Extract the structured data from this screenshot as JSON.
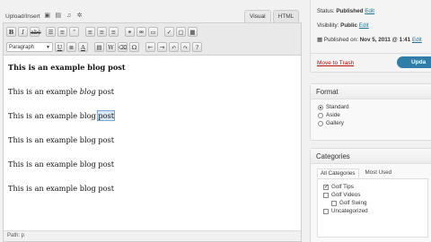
{
  "editor": {
    "upload_label": "Upload/Insert",
    "upload_icons": [
      "image-icon",
      "video-icon",
      "audio-icon",
      "media-icon"
    ],
    "tabs": {
      "visual": "Visual",
      "html": "HTML"
    },
    "toolbar_row1": [
      "B",
      "I",
      "abc",
      "list",
      "list",
      "quote",
      "left",
      "center",
      "right",
      "link",
      "unlink",
      "more",
      "spell",
      "full",
      "kitchen"
    ],
    "toolbar_row2": [
      "U",
      "justify",
      "A",
      "paste-text",
      "paste-word",
      "clear",
      "char",
      "outdent",
      "indent",
      "undo",
      "redo",
      "help"
    ],
    "paragraph_select": "Paragraph",
    "content": {
      "line1": "This is an example blog post",
      "line2_before": "This is an example ",
      "line2_em": "blog",
      "line2_after": " post",
      "line3_before": "This is an example blog ",
      "line3_selected": "post",
      "line4": "This is an example blog post",
      "line5": "This is an example blog post",
      "line6": "This is an example blog post"
    },
    "path": "Path: p"
  },
  "publish": {
    "status_label": "Status: ",
    "status_value": "Published",
    "status_edit": "Edit",
    "visibility_label": "Visibility: ",
    "visibility_value": "Public",
    "visibility_edit": "Edit",
    "published_on": "Published on: ",
    "published_date": "Nov 5, 2011 @ 1:41",
    "published_edit": "Edit",
    "trash": "Move to Trash",
    "update": "Upda"
  },
  "format": {
    "title": "Format",
    "options": [
      "Standard",
      "Aside",
      "Gallery"
    ],
    "selected": "Standard"
  },
  "categories": {
    "title": "Categories",
    "tab_all": "All Categories",
    "tab_used": "Most Used",
    "items": [
      {
        "label": "Golf Tips",
        "checked": true,
        "child": false
      },
      {
        "label": "Golf Videos",
        "checked": false,
        "child": false
      },
      {
        "label": "Golf Swing",
        "checked": false,
        "child": true
      },
      {
        "label": "Uncategorized",
        "checked": false,
        "child": false
      }
    ]
  }
}
